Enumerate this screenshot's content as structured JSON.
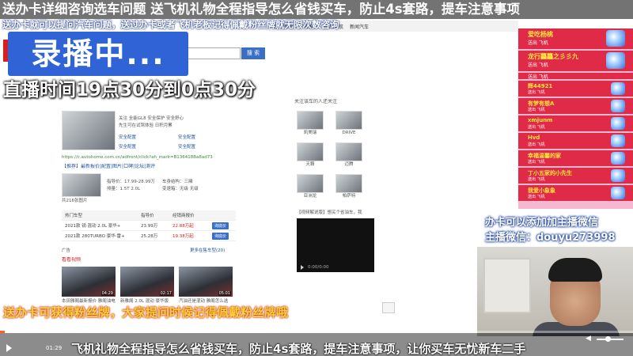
{
  "overlay": {
    "top_banner": "送办卡详细咨询选车问题 送飞机礼物全程指导怎么省钱买车，防止4s套路，提车注意事项",
    "sub_banner": "送办卡就可以提问汽车问题，送过办卡或者飞机老板记得佩戴粉丝牌就无限次数咨询",
    "live_badge": "录播中...",
    "live_time": "直播时间19点30分到0点30分",
    "wechat_line_1": "办卡可以添加加主播微信",
    "wechat_line_2": "主播微信：douyu273998",
    "marquee_1": "送办卡可获得粉丝牌，大家提问时候记得佩戴粉丝牌哦",
    "marquee_2": "飞机礼物全程指导怎么省钱买车，防止4s套路，提车注意事项，让你买车无忧新车二手"
  },
  "gift_panel": {
    "items": [
      {
        "name": "爱吃杨桃",
        "desc": "送出 飞机"
      },
      {
        "name": "龙行龘龘之彡彡九",
        "desc": "送出 飞机"
      },
      {
        "name": "",
        "desc": "送出 飞机"
      },
      {
        "name": "辉44921",
        "desc": "送出 飞机"
      },
      {
        "name": "有梦有想A",
        "desc": "送出 飞机"
      },
      {
        "name": "xmjunm",
        "desc": "送出 飞机"
      },
      {
        "name": "Hvd",
        "desc": "送出 飞机"
      },
      {
        "name": "幸福温馨的家",
        "desc": "送出 飞机"
      },
      {
        "name": "丁小五家的小先生",
        "desc": "送出 飞机"
      },
      {
        "name": "我爱小象象",
        "desc": "送出 飞机"
      }
    ]
  },
  "browser": {
    "tabs": [
      "全球购物",
      "广告推广",
      "产品导航",
      "新闻汽车"
    ],
    "search_button": "搜 索",
    "summary_lines": [
      "关注 全能GL8 安全保护 安全舒心",
      "先生可在试驾体验 日积月累"
    ],
    "links": [
      "安全配置",
      "安全配置",
      "安全配置",
      "安全配置"
    ],
    "url": "https://c.autohome.com.cn/adfront/click?ah_mark=B136418Ba8ad73",
    "price_title": "【推荐】最新报价|配置|图片|口碑|论坛|测评",
    "specs": [
      "指导价：17.99-28.99万",
      "车身结构：三厢",
      "排量：1.5T 2.0L",
      "变速箱：无级 无级"
    ],
    "image_caption": "共216张图片",
    "table_headers": [
      "热门车型",
      "指导价",
      "经销商报价"
    ],
    "table_rows": [
      {
        "name": "2021款 锐·混动 2.0L 豪华+",
        "price": "23.99万",
        "dealer": "22.88万起",
        "action": "询底价"
      },
      {
        "name": "2021款 280TURBO 豪华·雷+",
        "price": "25.28万",
        "dealer": "19.38万起",
        "action": "询底价"
      }
    ],
    "more_models": "更多在售车型(20)",
    "ad_label": "广告",
    "videos_title": "看看视频",
    "videos": [
      {
        "duration": "04:29",
        "caption": "本田雅阁最新报价 雅阁油电"
      },
      {
        "duration": "02:17",
        "caption": "新雅阁 2.0L 混动 豪华版"
      },
      {
        "duration": "05:01",
        "caption": "汽油还是混动 雅阁怎么选"
      }
    ],
    "followers_title": "关注该车的人还关注",
    "followed_cars": [
      "凯美瑞",
      "DRIVE",
      "天籁",
      "迈腾",
      "亚洲龙",
      "帕萨特"
    ],
    "video_player_title": "【视频解说版】想买个省油车，我",
    "player_time": "0:00/0:00"
  },
  "player": {
    "time": "01:29",
    "progress": 0.008
  }
}
